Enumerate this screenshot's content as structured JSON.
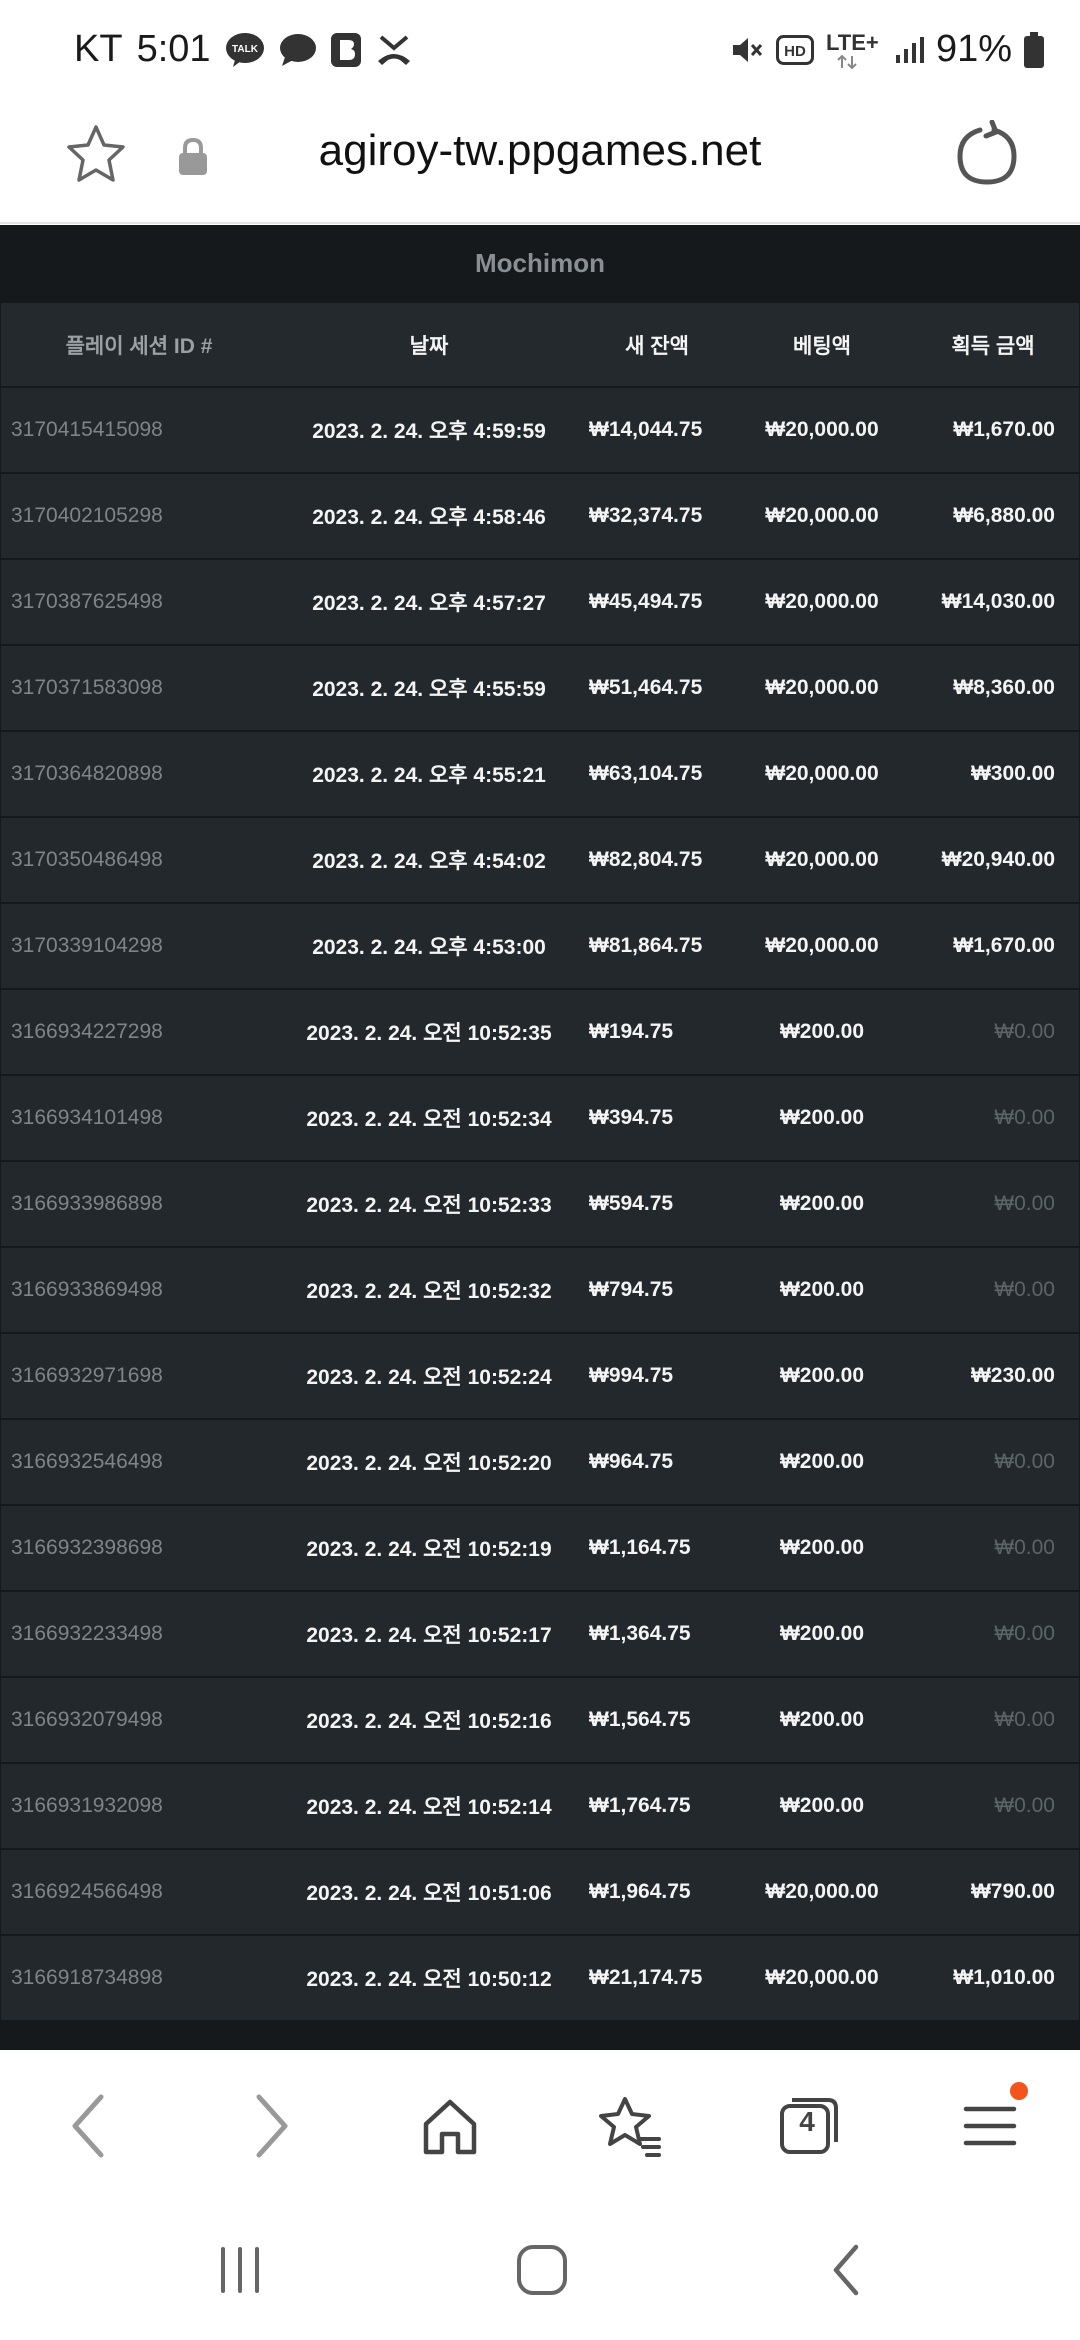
{
  "status_bar": {
    "carrier": "KT",
    "time": "5:01",
    "battery_percent": "91%",
    "network": "LTE+",
    "talk_badge": "TALK",
    "hd_badge": "HD"
  },
  "browser": {
    "url": "agiroy-tw.ppgames.net",
    "tab_count": "4"
  },
  "game": {
    "title": "Mochimon"
  },
  "table": {
    "headers": {
      "session_id": "플레이 세션 ID #",
      "date": "날짜",
      "new_balance": "새 잔액",
      "bet_amount": "베팅액",
      "win_amount": "획득 금액"
    },
    "rows": [
      {
        "id": "3170415415098",
        "date": "2023. 2. 24. 오후 4:59:59",
        "balance": "₩14,044.75",
        "bet": "₩20,000.00",
        "win": "₩1,670.00"
      },
      {
        "id": "3170402105298",
        "date": "2023. 2. 24. 오후 4:58:46",
        "balance": "₩32,374.75",
        "bet": "₩20,000.00",
        "win": "₩6,880.00"
      },
      {
        "id": "3170387625498",
        "date": "2023. 2. 24. 오후 4:57:27",
        "balance": "₩45,494.75",
        "bet": "₩20,000.00",
        "win": "₩14,030.00"
      },
      {
        "id": "3170371583098",
        "date": "2023. 2. 24. 오후 4:55:59",
        "balance": "₩51,464.75",
        "bet": "₩20,000.00",
        "win": "₩8,360.00"
      },
      {
        "id": "3170364820898",
        "date": "2023. 2. 24. 오후 4:55:21",
        "balance": "₩63,104.75",
        "bet": "₩20,000.00",
        "win": "₩300.00"
      },
      {
        "id": "3170350486498",
        "date": "2023. 2. 24. 오후 4:54:02",
        "balance": "₩82,804.75",
        "bet": "₩20,000.00",
        "win": "₩20,940.00"
      },
      {
        "id": "3170339104298",
        "date": "2023. 2. 24. 오후 4:53:00",
        "balance": "₩81,864.75",
        "bet": "₩20,000.00",
        "win": "₩1,670.00"
      },
      {
        "id": "3166934227298",
        "date": "2023. 2. 24. 오전 10:52:35",
        "balance": "₩194.75",
        "bet": "₩200.00",
        "win": "₩0.00"
      },
      {
        "id": "3166934101498",
        "date": "2023. 2. 24. 오전 10:52:34",
        "balance": "₩394.75",
        "bet": "₩200.00",
        "win": "₩0.00"
      },
      {
        "id": "3166933986898",
        "date": "2023. 2. 24. 오전 10:52:33",
        "balance": "₩594.75",
        "bet": "₩200.00",
        "win": "₩0.00"
      },
      {
        "id": "3166933869498",
        "date": "2023. 2. 24. 오전 10:52:32",
        "balance": "₩794.75",
        "bet": "₩200.00",
        "win": "₩0.00"
      },
      {
        "id": "3166932971698",
        "date": "2023. 2. 24. 오전 10:52:24",
        "balance": "₩994.75",
        "bet": "₩200.00",
        "win": "₩230.00"
      },
      {
        "id": "3166932546498",
        "date": "2023. 2. 24. 오전 10:52:20",
        "balance": "₩964.75",
        "bet": "₩200.00",
        "win": "₩0.00"
      },
      {
        "id": "3166932398698",
        "date": "2023. 2. 24. 오전 10:52:19",
        "balance": "₩1,164.75",
        "bet": "₩200.00",
        "win": "₩0.00"
      },
      {
        "id": "3166932233498",
        "date": "2023. 2. 24. 오전 10:52:17",
        "balance": "₩1,364.75",
        "bet": "₩200.00",
        "win": "₩0.00"
      },
      {
        "id": "3166932079498",
        "date": "2023. 2. 24. 오전 10:52:16",
        "balance": "₩1,564.75",
        "bet": "₩200.00",
        "win": "₩0.00"
      },
      {
        "id": "3166931932098",
        "date": "2023. 2. 24. 오전 10:52:14",
        "balance": "₩1,764.75",
        "bet": "₩200.00",
        "win": "₩0.00"
      },
      {
        "id": "3166924566498",
        "date": "2023. 2. 24. 오전 10:51:06",
        "balance": "₩1,964.75",
        "bet": "₩20,000.00",
        "win": "₩790.00"
      },
      {
        "id": "3166918734898",
        "date": "2023. 2. 24. 오전 10:50:12",
        "balance": "₩21,174.75",
        "bet": "₩20,000.00",
        "win": "₩1,010.00"
      }
    ]
  },
  "colors": {
    "background_dark": "#15191b",
    "row_bg": "#22282b",
    "header_bg": "#23292c",
    "notification_dot": "#f2541b"
  },
  "icons": {
    "status": [
      "kakaotalk-icon",
      "message-icon",
      "blog-icon",
      "missed-call-icon",
      "mute-icon",
      "hd-icon",
      "lte-icon",
      "signal-icon",
      "battery-icon"
    ],
    "browser": [
      "bookmark-star-icon",
      "lock-icon",
      "reload-icon"
    ],
    "toolbar": [
      "back-icon",
      "forward-icon",
      "home-icon",
      "bookmarks-icon",
      "tabs-icon",
      "menu-icon"
    ],
    "nav": [
      "recents-icon",
      "home-nav-icon",
      "back-nav-icon"
    ]
  }
}
